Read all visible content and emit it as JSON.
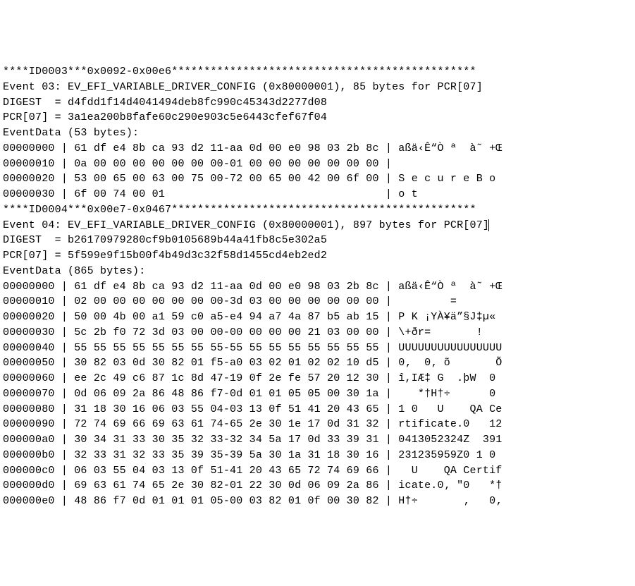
{
  "lines": [
    "****ID0003***0x0092-0x00e6***********************************************",
    "Event 03: EV_EFI_VARIABLE_DRIVER_CONFIG (0x80000001), 85 bytes for PCR[07]",
    "DIGEST  = d4fdd1f14d4041494deb8fc990c45343d2277d08",
    "PCR[07] = 3a1ea200b8fafe60c290e903c5e6443cfef67f04",
    "EventData (53 bytes):",
    "00000000 | 61 df e4 8b ca 93 d2 11-aa 0d 00 e0 98 03 2b 8c | aßä‹Ê“Ò ª  à˜ +Œ",
    "00000010 | 0a 00 00 00 00 00 00 00-01 00 00 00 00 00 00 00 |",
    "00000020 | 53 00 65 00 63 00 75 00-72 00 65 00 42 00 6f 00 | S e c u r e B o",
    "00000030 | 6f 00 74 00 01                                  | o t",
    "****ID0004***0x00e7-0x0467***********************************************",
    "Event 04: EV_EFI_VARIABLE_DRIVER_CONFIG (0x80000001), 897 bytes for PCR[07]",
    "DIGEST  = b26170979280cf9b0105689b44a41fb8c5e302a5",
    "PCR[07] = 5f599e9f15b00f4b49d3c32f58d1455cd4eb2ed2",
    "EventData (865 bytes):",
    "00000000 | 61 df e4 8b ca 93 d2 11-aa 0d 00 e0 98 03 2b 8c | aßä‹Ê“Ò ª  à˜ +Œ",
    "00000010 | 02 00 00 00 00 00 00 00-3d 03 00 00 00 00 00 00 |         =",
    "00000020 | 50 00 4b 00 a1 59 c0 a5-e4 94 a7 4a 87 b5 ab 15 | P K ¡YÀ¥ä”§J‡µ«",
    "00000030 | 5c 2b f0 72 3d 03 00 00-00 00 00 00 21 03 00 00 | \\+ðr=       !",
    "00000040 | 55 55 55 55 55 55 55 55-55 55 55 55 55 55 55 55 | UUUUUUUUUUUUUUUU",
    "00000050 | 30 82 03 0d 30 82 01 f5-a0 03 02 01 02 02 10 d5 | 0‚  0‚ õ       Õ",
    "00000060 | ee 2c 49 c6 87 1c 8d 47-19 0f 2e fe 57 20 12 30 | î,IÆ‡ G  .þW  0",
    "00000070 | 0d 06 09 2a 86 48 86 f7-0d 01 01 05 05 00 30 1a |    *†H†÷      0",
    "00000080 | 31 18 30 16 06 03 55 04-03 13 0f 51 41 20 43 65 | 1 0   U    QA Ce",
    "00000090 | 72 74 69 66 69 63 61 74-65 2e 30 1e 17 0d 31 32 | rtificate.0   12",
    "000000a0 | 30 34 31 33 30 35 32 33-32 34 5a 17 0d 33 39 31 | 0413052324Z  391",
    "000000b0 | 32 33 31 32 33 35 39 35-39 5a 30 1a 31 18 30 16 | 231235959Z0 1 0",
    "000000c0 | 06 03 55 04 03 13 0f 51-41 20 43 65 72 74 69 66 |   U    QA Certif",
    "000000d0 | 69 63 61 74 65 2e 30 82-01 22 30 0d 06 09 2a 86 | icate.0‚ \"0   *†",
    "000000e0 | 48 86 f7 0d 01 01 01 05-00 03 82 01 0f 00 30 82 | H†÷       ‚   0‚"
  ],
  "cursor_line": 10
}
